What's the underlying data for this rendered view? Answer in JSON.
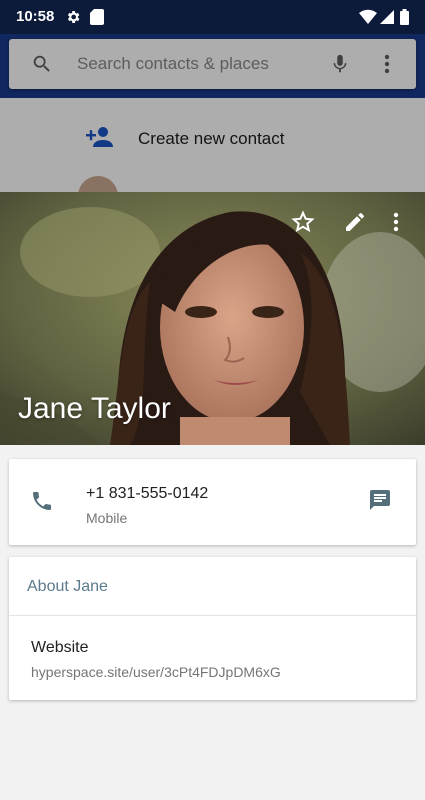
{
  "status_bar": {
    "time": "10:58",
    "icons": [
      "settings-icon",
      "sim-card-icon",
      "wifi-icon",
      "signal-icon",
      "battery-icon"
    ]
  },
  "search": {
    "placeholder": "Search contacts & places",
    "icons": [
      "search-icon",
      "mic-icon",
      "more-vert-icon"
    ]
  },
  "background_list": {
    "create_label": "Create new contact"
  },
  "contact": {
    "name": "Jane Taylor",
    "header_actions": [
      "star-icon",
      "edit-icon",
      "more-vert-icon"
    ]
  },
  "phone_card": {
    "number": "+1 831-555-0142",
    "type": "Mobile"
  },
  "about_card": {
    "title": "About Jane",
    "website_label": "Website",
    "website_url": "hyperspace.site/user/3cPt4FDJpDM6xG"
  },
  "colors": {
    "status_bar": "#0d1b3a",
    "header": "#1a3a8c",
    "accent_icon": "#546e7a",
    "about_title": "#5b7a8c"
  }
}
